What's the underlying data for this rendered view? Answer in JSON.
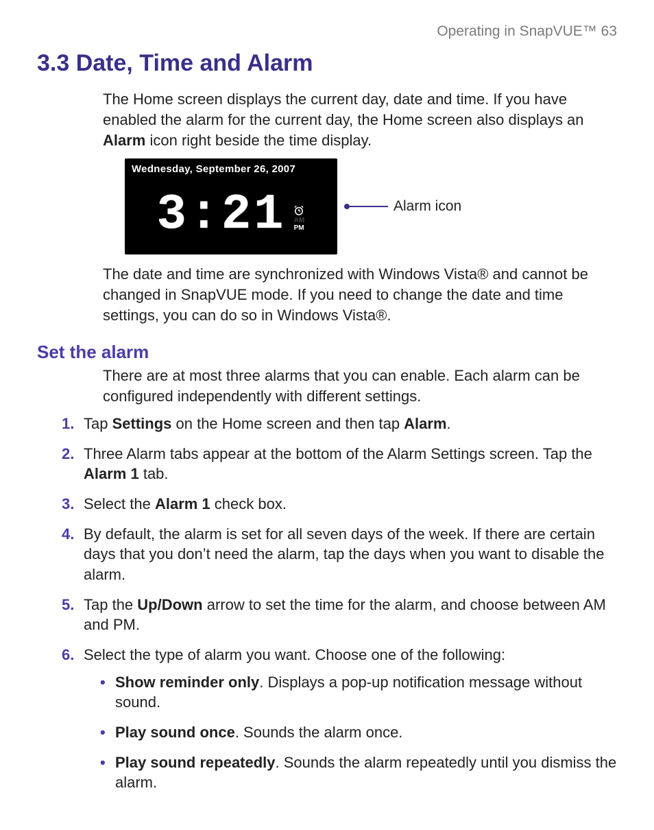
{
  "runhead": "Operating in SnapVUE™  63",
  "section_title": "3.3  Date, Time and Alarm",
  "intro_html": "The Home screen displays the current day, date and time. If you have enabled the alarm for the current day, the Home screen also displays an <b>Alarm</b> icon right beside the time display.",
  "figure": {
    "date": "Wednesday, September 26, 2007",
    "time": "3:21",
    "am": "AM",
    "pm": "PM",
    "callout": "Alarm icon"
  },
  "sync_html": "The date and time are synchronized with Windows Vista® and cannot be changed in SnapVUE mode. If you need to change the date and time settings, you can do so in Windows Vista®.",
  "subhead": "Set the alarm",
  "subintro": "There are at most three alarms that you can enable. Each alarm can be configured independently with different settings.",
  "steps": [
    {
      "num": "1.",
      "html": "Tap <b>Settings</b> on the Home screen and then tap <b>Alarm</b>."
    },
    {
      "num": "2.",
      "html": "Three Alarm tabs appear at the bottom of the Alarm Settings screen. Tap the <b>Alarm 1</b> tab."
    },
    {
      "num": "3.",
      "html": "Select the <b>Alarm 1</b> check box."
    },
    {
      "num": "4.",
      "html": "By default, the alarm is set for all seven days of the week. If there are certain days that you don’t need the alarm, tap the days when you want to disable the alarm."
    },
    {
      "num": "5.",
      "html": "Tap the <b>Up/Down</b> arrow to set the time for the alarm, and choose between AM and PM."
    },
    {
      "num": "6.",
      "html": "Select the type of alarm you want. Choose one of the following:"
    }
  ],
  "bullets": [
    {
      "html": "<b>Show reminder only</b>. Displays a pop-up notification message without sound."
    },
    {
      "html": "<b>Play sound once</b>. Sounds the alarm once."
    },
    {
      "html": "<b>Play sound repeatedly</b>. Sounds the alarm repeatedly until you dismiss the alarm."
    }
  ]
}
